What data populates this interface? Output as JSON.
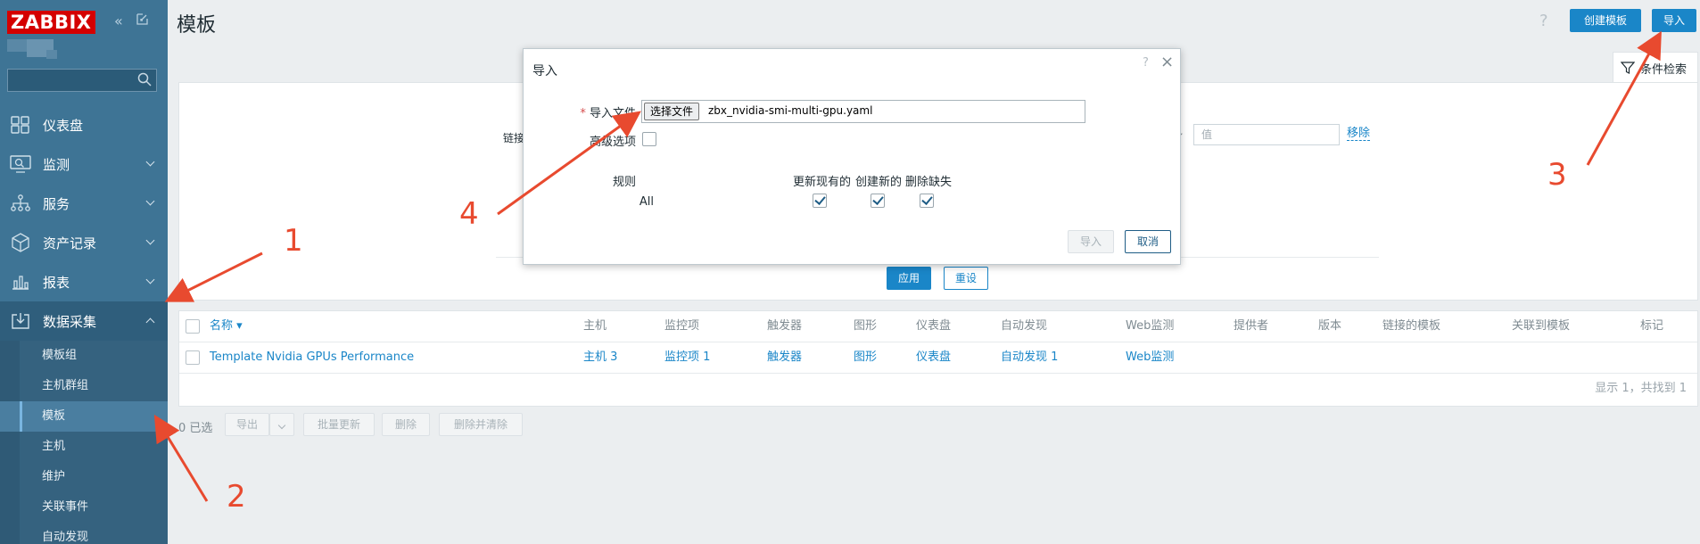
{
  "app": {
    "logo": "ZABBIX"
  },
  "sidebar": {
    "menu": [
      {
        "label": "仪表盘",
        "icon": "dashboard-icon"
      },
      {
        "label": "监测",
        "icon": "monitoring-icon"
      },
      {
        "label": "服务",
        "icon": "services-icon"
      },
      {
        "label": "资产记录",
        "icon": "inventory-icon"
      },
      {
        "label": "报表",
        "icon": "reports-icon"
      },
      {
        "label": "数据采集",
        "icon": "data-collection-icon"
      }
    ],
    "submenu": [
      "模板组",
      "主机群组",
      "模板",
      "主机",
      "维护",
      "关联事件",
      "自动发现"
    ]
  },
  "header": {
    "title": "模板",
    "help": "?",
    "create_template": "创建模板",
    "import": "导入"
  },
  "filter": {
    "tab_label": "条件检索",
    "linked_label": "链接",
    "value_placeholder": "值",
    "remove": "移除",
    "apply": "应用",
    "reset": "重设"
  },
  "table": {
    "headers": [
      "名称 ▾",
      "主机",
      "监控项",
      "触发器",
      "图形",
      "仪表盘",
      "自动发现",
      "Web监测",
      "提供者",
      "版本",
      "链接的模板",
      "关联到模板",
      "标记"
    ],
    "rows": [
      {
        "name": "Template Nvidia GPUs Performance",
        "hosts": "主机 3",
        "items": "监控项 1",
        "triggers": "触发器",
        "graphs": "图形",
        "dashboards": "仪表盘",
        "discovery": "自动发现 1",
        "web": "Web监测"
      }
    ],
    "footer": "显示 1，共找到 1"
  },
  "actions": {
    "selected": "0 已选",
    "export": "导出",
    "mass_update": "批量更新",
    "delete": "删除",
    "delete_clear": "删除并清除"
  },
  "modal": {
    "title": "导入",
    "help": "?",
    "close": "×",
    "required_mark": "*",
    "file_label": "导入文件",
    "file_button": "选择文件",
    "file_name": "zbx_nvidia-smi-multi-gpu.yaml",
    "advanced_label": "高级选项",
    "rules_label": "规则",
    "col_update": "更新现有的",
    "col_create": "创建新的",
    "col_delete": "删除缺失",
    "row_all": "All",
    "import_btn": "导入",
    "cancel_btn": "取消"
  },
  "annotations": [
    "1",
    "2",
    "3",
    "4"
  ],
  "colors": {
    "accent": "#1a86c8",
    "sidebar": "#3e7495",
    "annotation": "#e84a2f",
    "logo": "#d40000"
  }
}
